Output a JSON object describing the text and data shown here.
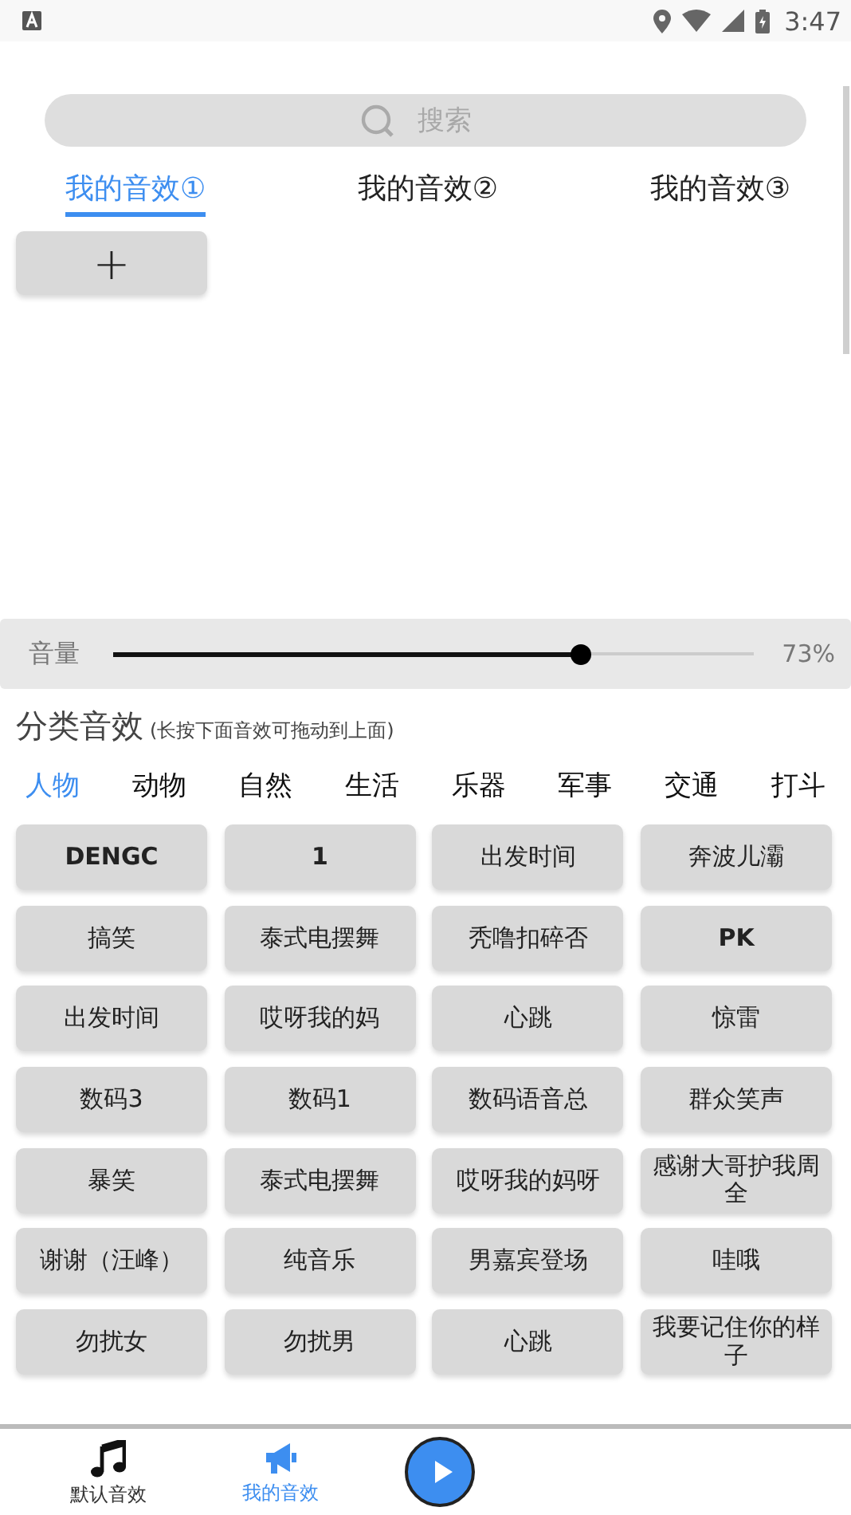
{
  "status_bar": {
    "time": "3:47"
  },
  "search": {
    "placeholder": "搜索"
  },
  "my_tabs": [
    {
      "label": "我的音效①",
      "selected": true
    },
    {
      "label": "我的音效②",
      "selected": false
    },
    {
      "label": "我的音效③",
      "selected": false
    }
  ],
  "add_button": {
    "label": "+"
  },
  "volume": {
    "label": "音量",
    "level": 0.73,
    "reading": "73%"
  },
  "section": {
    "title": "分类音效",
    "hint": "(长按下面音效可拖动到上面)"
  },
  "categories": [
    {
      "label": "人物",
      "selected": true
    },
    {
      "label": "动物",
      "selected": false
    },
    {
      "label": "自然",
      "selected": false
    },
    {
      "label": "生活",
      "selected": false
    },
    {
      "label": "乐器",
      "selected": false
    },
    {
      "label": "军事",
      "selected": false
    },
    {
      "label": "交通",
      "selected": false
    },
    {
      "label": "打斗",
      "selected": false
    }
  ],
  "sounds": [
    {
      "label": "DENGC",
      "bold": true
    },
    {
      "label": "1",
      "bold": true
    },
    {
      "label": "出发时间",
      "bold": false
    },
    {
      "label": "奔波儿灞",
      "bold": false
    },
    {
      "label": "搞笑",
      "bold": false
    },
    {
      "label": "泰式电摆舞",
      "bold": false
    },
    {
      "label": "秃噜扣碎否",
      "bold": false
    },
    {
      "label": "PK",
      "bold": true
    },
    {
      "label": "出发时间",
      "bold": false
    },
    {
      "label": "哎呀我的妈",
      "bold": false
    },
    {
      "label": "心跳",
      "bold": false
    },
    {
      "label": "惊雷",
      "bold": false
    },
    {
      "label": "数码3",
      "bold": false
    },
    {
      "label": "数码1",
      "bold": false
    },
    {
      "label": "数码语音总",
      "bold": false
    },
    {
      "label": "群众笑声",
      "bold": false
    },
    {
      "label": "暴笑",
      "bold": false
    },
    {
      "label": "泰式电摆舞",
      "bold": false
    },
    {
      "label": "哎呀我的妈呀",
      "bold": false
    },
    {
      "label": "感谢大哥护我周全",
      "bold": false
    },
    {
      "label": "谢谢（汪峰）",
      "bold": false
    },
    {
      "label": "纯音乐",
      "bold": false
    },
    {
      "label": "男嘉宾登场",
      "bold": false
    },
    {
      "label": "哇哦",
      "bold": false
    },
    {
      "label": "勿扰女",
      "bold": false
    },
    {
      "label": "勿扰男",
      "bold": false
    },
    {
      "label": "心跳",
      "bold": false
    },
    {
      "label": "我要记住你的样子",
      "bold": false
    }
  ],
  "bottom_nav": [
    {
      "kind": "music",
      "label": "默认音效",
      "selected": false
    },
    {
      "kind": "megaphone",
      "label": "我的音效",
      "selected": true
    },
    {
      "kind": "play"
    }
  ]
}
